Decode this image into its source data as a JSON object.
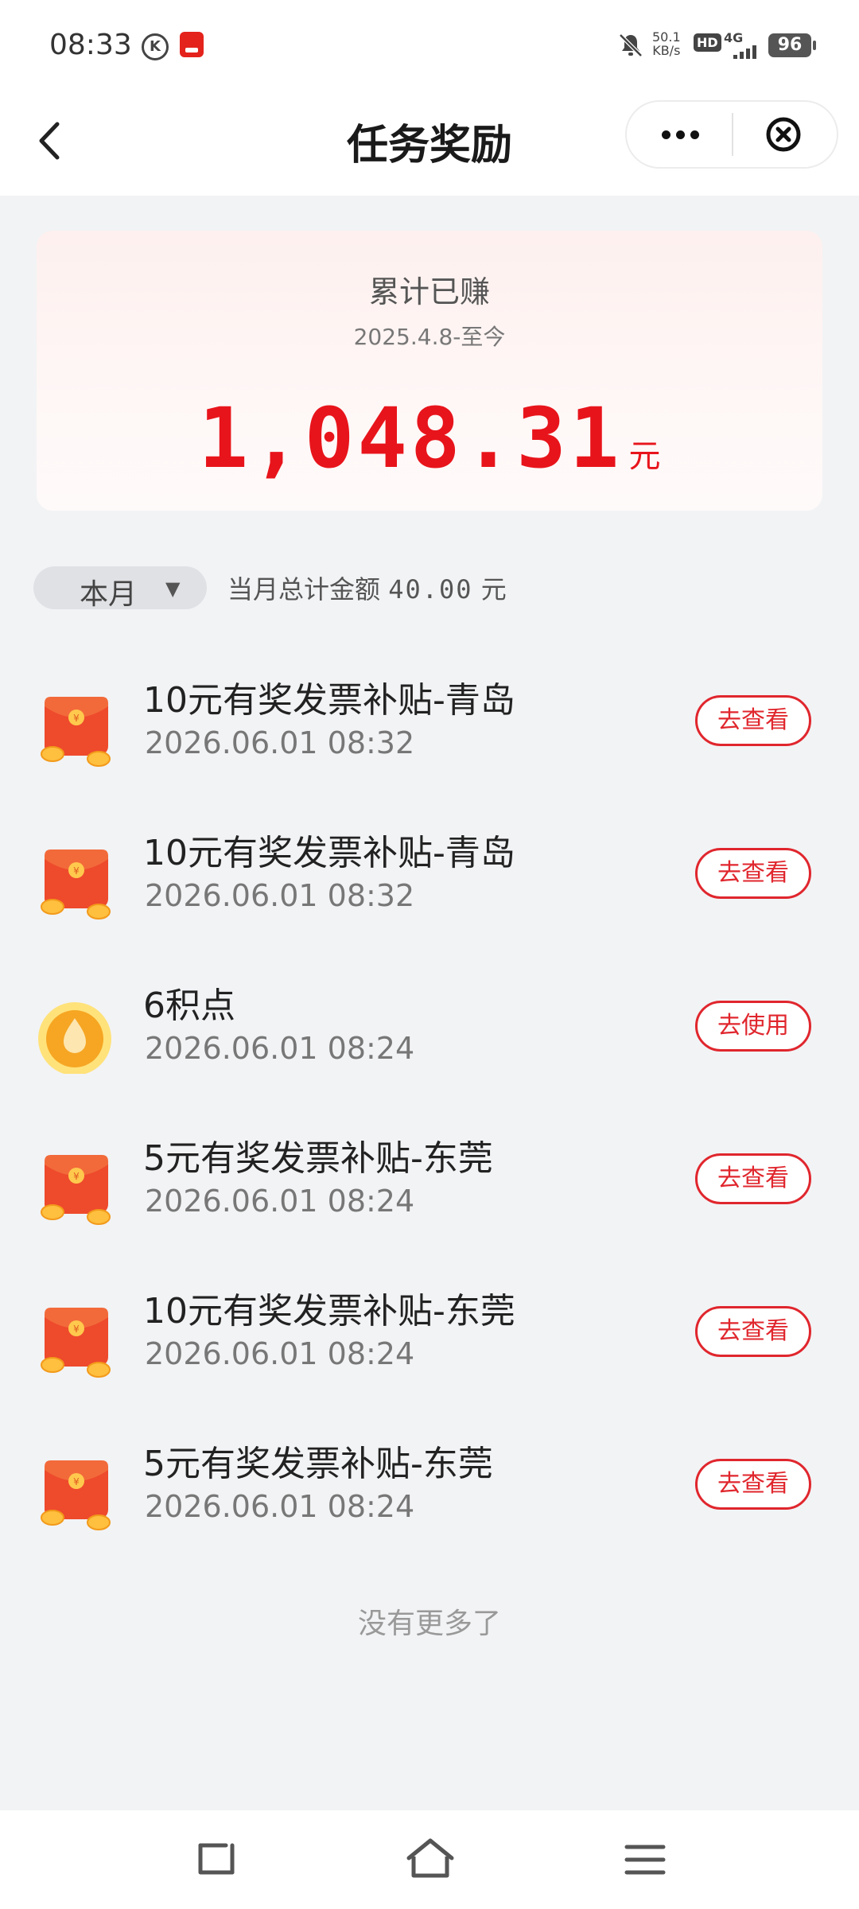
{
  "status_bar": {
    "time": "08:33",
    "network_speed_value": "50.1",
    "network_speed_unit": "KB/s",
    "hd_badge": "HD",
    "network_type": "4G",
    "battery": "96",
    "icons": [
      "k-circle-icon",
      "red-app-icon",
      "bell-muted-icon",
      "signal-icon",
      "battery-icon"
    ]
  },
  "nav": {
    "title": "任务奖励",
    "icons": [
      "back-chevron-icon",
      "more-dots-icon",
      "close-circle-icon"
    ]
  },
  "summary": {
    "label": "累计已赚",
    "period": "2025.4.8-至今",
    "amount": "1,048.31",
    "unit": "元"
  },
  "filter": {
    "month_label": "本月",
    "caret": "▼",
    "total_prefix": "当月总计金额",
    "total_value": "40.00",
    "total_unit": "元"
  },
  "colors": {
    "accent_red": "#e8141b",
    "button_red": "#e0262d",
    "background": "#f2f3f5"
  },
  "rewards": [
    {
      "icon": "red-envelope-icon",
      "title": "10元有奖发票补贴-青岛",
      "time": "2026.06.01 08:32",
      "action": "去查看"
    },
    {
      "icon": "red-envelope-icon",
      "title": "10元有奖发票补贴-青岛",
      "time": "2026.06.01 08:32",
      "action": "去查看"
    },
    {
      "icon": "points-drop-icon",
      "title": "6积点",
      "time": "2026.06.01 08:24",
      "action": "去使用"
    },
    {
      "icon": "red-envelope-icon",
      "title": "5元有奖发票补贴-东莞",
      "time": "2026.06.01 08:24",
      "action": "去查看"
    },
    {
      "icon": "red-envelope-icon",
      "title": "10元有奖发票补贴-东莞",
      "time": "2026.06.01 08:24",
      "action": "去查看"
    },
    {
      "icon": "red-envelope-icon",
      "title": "5元有奖发票补贴-东莞",
      "time": "2026.06.01 08:24",
      "action": "去查看"
    }
  ],
  "footer_text": "没有更多了",
  "bottom_nav": [
    "back-nav-icon",
    "home-nav-icon",
    "menu-nav-icon"
  ]
}
